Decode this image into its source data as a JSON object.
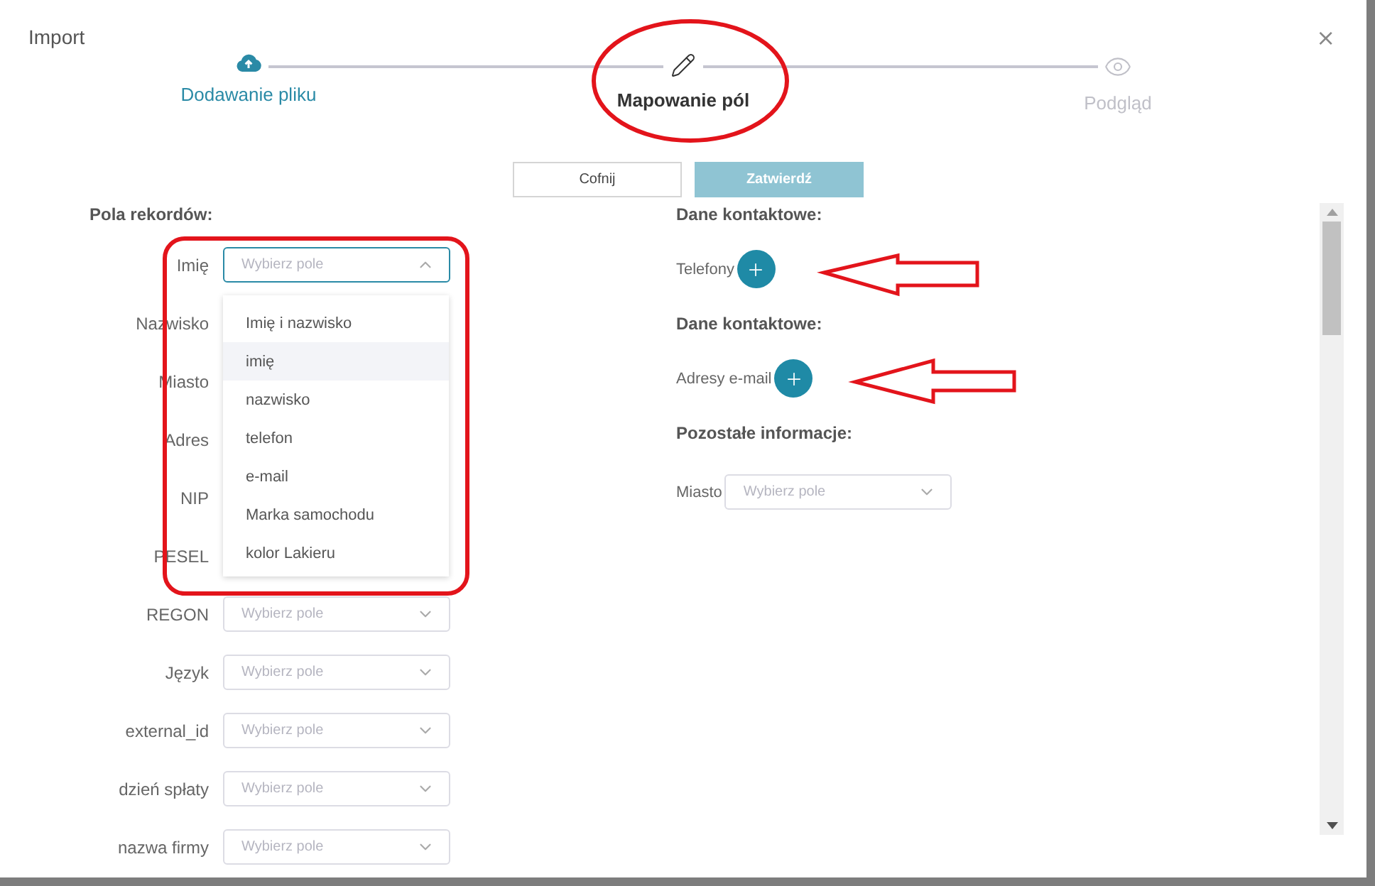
{
  "dialog": {
    "title": "Import",
    "close": "×"
  },
  "steps": [
    {
      "label": "Dodawanie pliku",
      "completed": true,
      "selected": false
    },
    {
      "label": "Mapowanie pól",
      "completed": false,
      "selected": true
    },
    {
      "label": "Podgląd",
      "completed": false,
      "selected": false
    }
  ],
  "actions": [
    {
      "label": "Cofnij",
      "kind": "secondary",
      "disabled": false
    },
    {
      "label": "Zatwierdź",
      "kind": "primary",
      "disabled": true
    }
  ],
  "record_fields": {
    "heading": "Pola rekordów:",
    "fields": [
      {
        "label": "Imię",
        "placeholder": "Wybierz pole",
        "open": true
      },
      {
        "label": "Nazwisko",
        "open": false
      },
      {
        "label": "Miasto",
        "open": false
      },
      {
        "label": "Adres",
        "open": false
      },
      {
        "label": "NIP",
        "open": false
      },
      {
        "label": "PESEL",
        "open": false
      },
      {
        "label": "REGON",
        "placeholder": "Wybierz pole",
        "open": false
      },
      {
        "label": "Język",
        "placeholder": "Wybierz pole",
        "open": false
      },
      {
        "label": "external_id",
        "placeholder": "Wybierz pole",
        "open": false
      },
      {
        "label": "dzień spłaty",
        "placeholder": "Wybierz pole",
        "open": false
      },
      {
        "label": "nazwa firmy",
        "placeholder": "Wybierz pole",
        "open": false
      }
    ]
  },
  "dropdown": {
    "options": [
      {
        "label": "Imię i nazwisko",
        "selected": false
      },
      {
        "label": "imię",
        "selected": true
      },
      {
        "label": "nazwisko",
        "selected": false
      },
      {
        "label": "telefon",
        "selected": false
      },
      {
        "label": "e-mail",
        "selected": false
      },
      {
        "label": "Marka samochodu",
        "selected": false
      },
      {
        "label": "kolor Lakieru",
        "selected": false
      }
    ]
  },
  "contact_sections": [
    {
      "heading": "Dane kontaktowe:",
      "label": "Telefony"
    },
    {
      "heading": "Dane kontaktowe:",
      "label": "Adresy e-mail"
    }
  ],
  "other_info": {
    "heading": "Pozostałe informacje:",
    "fields": [
      {
        "label": "Miasto",
        "placeholder": "Wybierz pole"
      }
    ]
  }
}
